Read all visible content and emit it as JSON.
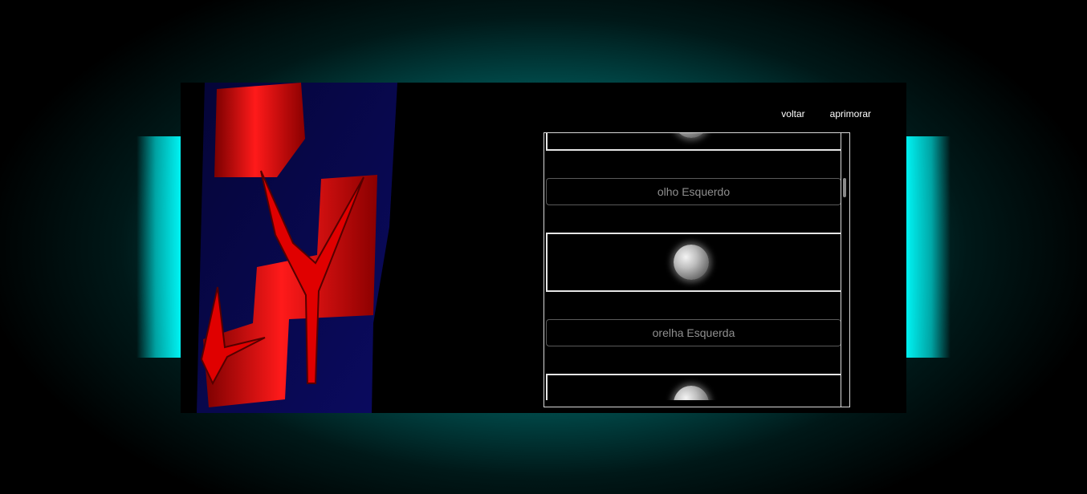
{
  "nav": {
    "back_label": "voltar",
    "refine_label": "aprimorar"
  },
  "list": {
    "items": [
      {
        "type": "image",
        "icon": "sphere-icon"
      },
      {
        "type": "label",
        "text": "olho Esquerdo"
      },
      {
        "type": "image",
        "icon": "sphere-icon"
      },
      {
        "type": "label",
        "text": "orelha Esquerda"
      },
      {
        "type": "image",
        "icon": "sphere-icon"
      }
    ]
  },
  "colors": {
    "background_glow": "#00ffff",
    "stage": "#000000",
    "logo_red": "#ff0000",
    "logo_blue": "#0a0a5a",
    "label_text": "#8f8f8f",
    "border": "#e6e6e6"
  }
}
